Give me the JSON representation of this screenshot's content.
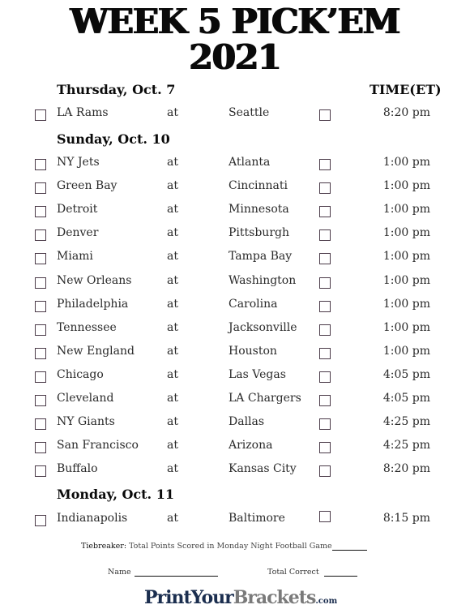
{
  "title": {
    "line1": "WEEK 5 PICK’EM",
    "line2": "2021"
  },
  "time_header": "TIME(ET)",
  "sections": [
    {
      "day": "Thursday, Oct. 7",
      "games": [
        {
          "away": "LA Rams",
          "sep": "at",
          "home": "Seattle",
          "time": "8:20 pm"
        }
      ]
    },
    {
      "day": "Sunday, Oct. 10",
      "games": [
        {
          "away": "NY Jets",
          "sep": "at",
          "home": "Atlanta",
          "time": "1:00 pm"
        },
        {
          "away": "Green Bay",
          "sep": "at",
          "home": "Cincinnati",
          "time": "1:00 pm"
        },
        {
          "away": "Detroit",
          "sep": "at",
          "home": "Minnesota",
          "time": "1:00 pm"
        },
        {
          "away": "Denver",
          "sep": "at",
          "home": "Pittsburgh",
          "time": "1:00 pm"
        },
        {
          "away": "Miami",
          "sep": "at",
          "home": "Tampa Bay",
          "time": "1:00 pm"
        },
        {
          "away": "New Orleans",
          "sep": "at",
          "home": "Washington",
          "time": "1:00 pm"
        },
        {
          "away": "Philadelphia",
          "sep": "at",
          "home": "Carolina",
          "time": "1:00 pm"
        },
        {
          "away": "Tennessee",
          "sep": "at",
          "home": "Jacksonville",
          "time": "1:00 pm"
        },
        {
          "away": "New England",
          "sep": "at",
          "home": "Houston",
          "time": "1:00 pm"
        },
        {
          "away": "Chicago",
          "sep": "at",
          "home": "Las Vegas",
          "time": "4:05 pm"
        },
        {
          "away": "Cleveland",
          "sep": "at",
          "home": "LA Chargers",
          "time": "4:05 pm"
        },
        {
          "away": "NY Giants",
          "sep": "at",
          "home": "Dallas",
          "time": "4:25 pm"
        },
        {
          "away": "San Francisco",
          "sep": "at",
          "home": "Arizona",
          "time": "4:25 pm"
        },
        {
          "away": "Buffalo",
          "sep": "at",
          "home": "Kansas City",
          "time": "8:20 pm"
        }
      ]
    },
    {
      "day": "Monday, Oct. 11",
      "games": [
        {
          "away": "Indianapolis",
          "sep": "at",
          "home": "Baltimore",
          "time": "8:15 pm"
        }
      ]
    }
  ],
  "footer": {
    "tiebreaker_label": "Tiebreaker:",
    "tiebreaker_text": "Total Points Scored in Monday Night Football Game",
    "name_label": "Name",
    "total_correct_label": "Total Correct"
  },
  "logo": {
    "part1": "PrintYour",
    "part2": "Brackets",
    "part3": ".com"
  }
}
